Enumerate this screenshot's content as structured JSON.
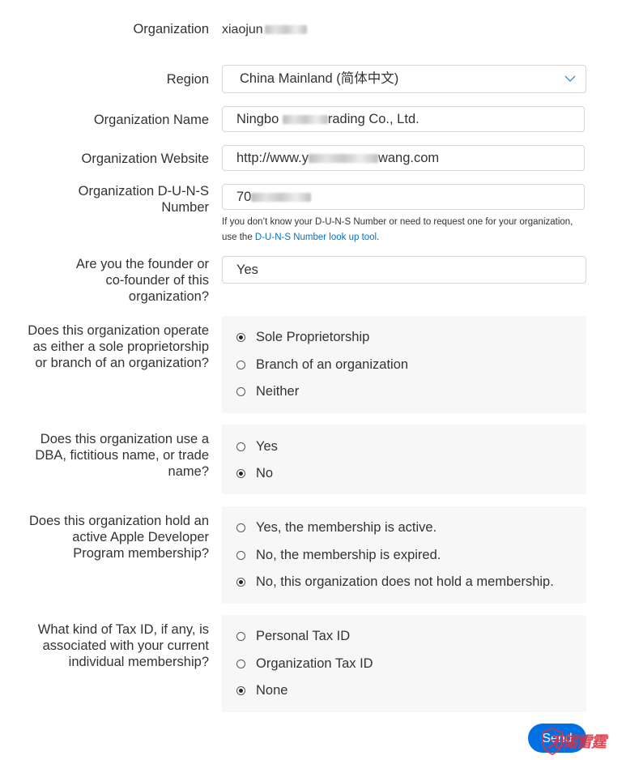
{
  "organization": {
    "label": "Organization",
    "value_visible": "xiaojun"
  },
  "region": {
    "label": "Region",
    "selected": "China Mainland (简体中文)",
    "icon": "chevron-down-icon"
  },
  "organization_name": {
    "label": "Organization Name",
    "value_prefix": "Ningbo",
    "value_suffix": "rading Co., Ltd."
  },
  "organization_website": {
    "label": "Organization Website",
    "value_prefix": "http://www.y",
    "value_suffix": "wang.com"
  },
  "duns": {
    "label_line1": "Organization D-U-N-S",
    "label_line2": "Number",
    "value_prefix": "70",
    "help_text": "If you don’t know your D-U-N-S Number or need to request one for your organization, use the ",
    "help_link": "D-U-N-S Number look up tool",
    "help_end": "."
  },
  "founder": {
    "label": "Are you the founder or co-founder of this organization?",
    "value": "Yes"
  },
  "structure": {
    "label": "Does this organization operate as either a sole proprietorship or branch of an organization?",
    "options": [
      {
        "label": "Sole Proprietorship",
        "checked": true
      },
      {
        "label": "Branch of an organization",
        "checked": false
      },
      {
        "label": "Neither",
        "checked": false
      }
    ]
  },
  "dba": {
    "label": "Does this organization use a DBA, fictitious name, or trade name?",
    "options": [
      {
        "label": "Yes",
        "checked": false
      },
      {
        "label": "No",
        "checked": true
      }
    ]
  },
  "membership": {
    "label": "Does this organization hold an active Apple Developer Program membership?",
    "options": [
      {
        "label": "Yes, the membership is active.",
        "checked": false
      },
      {
        "label": "No, the membership is expired.",
        "checked": false
      },
      {
        "label": "No, this organization does not hold a membership.",
        "checked": true
      }
    ]
  },
  "tax_id": {
    "label": "What kind of Tax ID, if any, is associated with your current individual membership?",
    "options": [
      {
        "label": "Personal Tax ID",
        "checked": false
      },
      {
        "label": "Organization Tax ID",
        "checked": false
      },
      {
        "label": "None",
        "checked": true
      }
    ]
  },
  "actions": {
    "send_label": "Send"
  },
  "watermark": {
    "text": "无锡雷霆"
  },
  "colors": {
    "accent": "#0071e3",
    "link": "#0070c9",
    "radio_box_bg": "#f7f7f7",
    "watermark": "#e0303f"
  }
}
